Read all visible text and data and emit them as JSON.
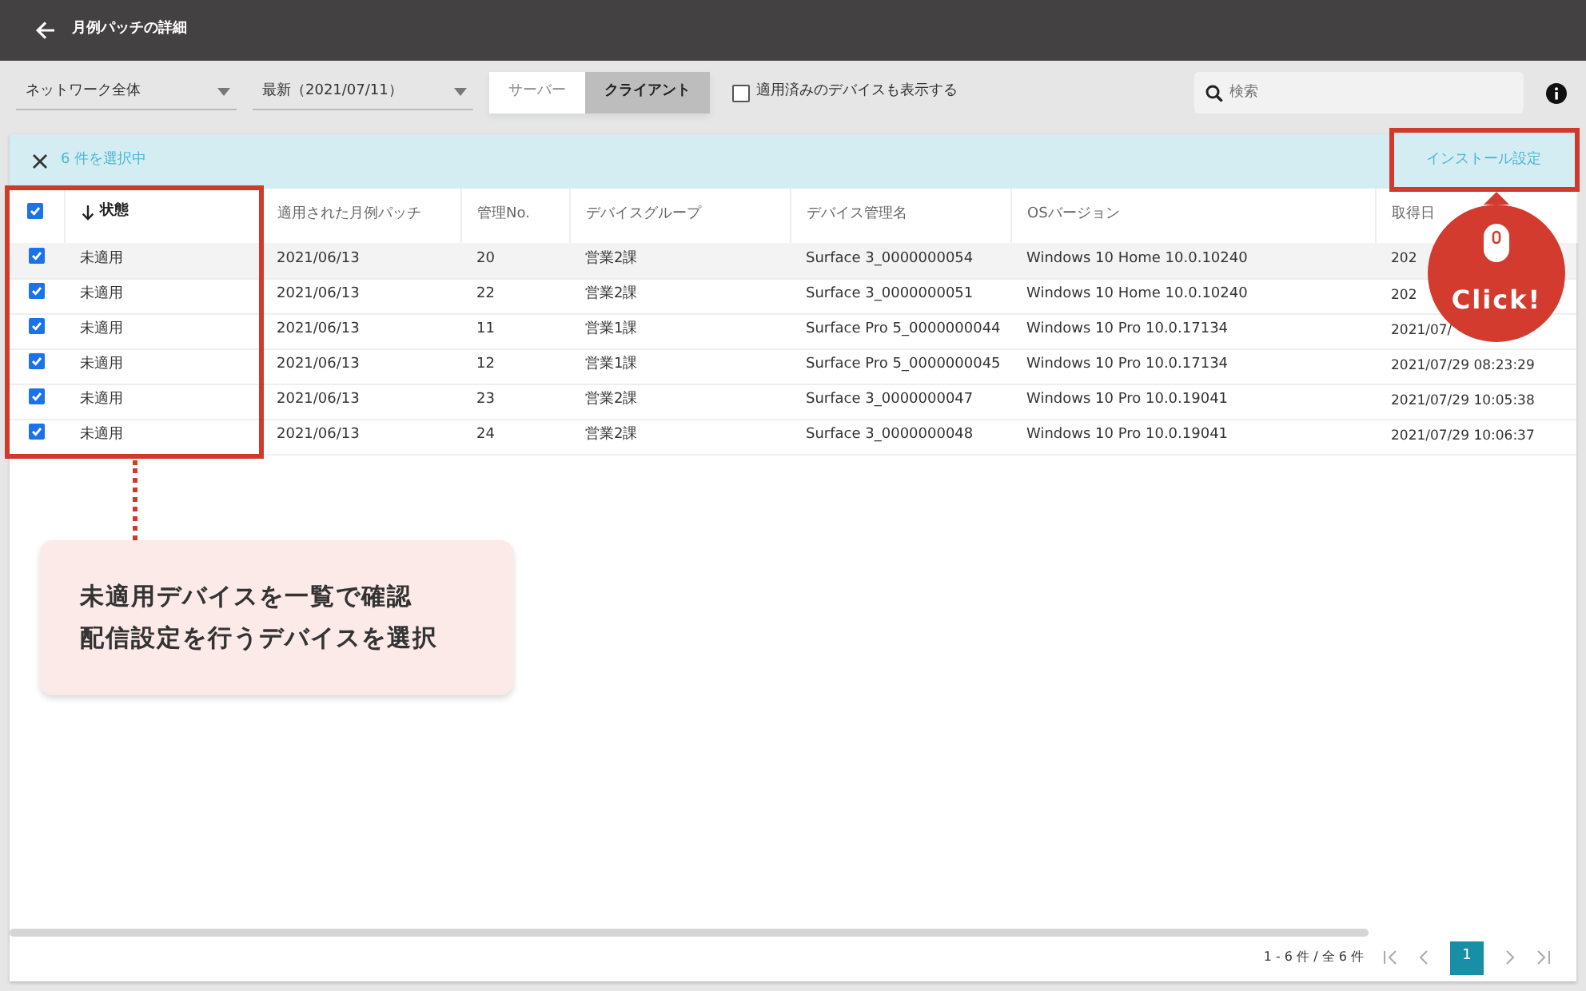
{
  "header": {
    "title": "月例パッチの詳細"
  },
  "toolbar": {
    "network_select": {
      "value": "ネットワーク全体"
    },
    "date_select": {
      "value": "最新（2021/07/11）"
    },
    "segments": [
      {
        "label": "サーバー",
        "selected": false
      },
      {
        "label": "クライアント",
        "selected": true
      }
    ],
    "show_applied": {
      "label": "適用済みのデバイスも表示する",
      "checked": false
    },
    "search": {
      "placeholder": "検索"
    }
  },
  "selection_bar": {
    "count_text": "6 件を選択中",
    "action": "インストール設定"
  },
  "table": {
    "all_checked": true,
    "columns": [
      {
        "label": "状態",
        "sorted": true
      },
      {
        "label": "適用された月例パッチ",
        "sorted": false
      },
      {
        "label": "管理No.",
        "sorted": false
      },
      {
        "label": "デバイスグループ",
        "sorted": false
      },
      {
        "label": "デバイス管理名",
        "sorted": false
      },
      {
        "label": "OSバージョン",
        "sorted": false
      },
      {
        "label": "取得日",
        "sorted": false
      }
    ],
    "rows": [
      {
        "checked": true,
        "cells": [
          "未適用",
          "2021/06/13",
          "20",
          "営業2課",
          "Surface 3_0000000054",
          "Windows 10 Home 10.0.10240",
          "202"
        ]
      },
      {
        "checked": true,
        "cells": [
          "未適用",
          "2021/06/13",
          "22",
          "営業2課",
          "Surface 3_0000000051",
          "Windows 10 Home 10.0.10240",
          "202"
        ]
      },
      {
        "checked": true,
        "cells": [
          "未適用",
          "2021/06/13",
          "11",
          "営業1課",
          "Surface Pro 5_0000000044",
          "Windows 10 Pro 10.0.17134",
          "2021/07/"
        ]
      },
      {
        "checked": true,
        "cells": [
          "未適用",
          "2021/06/13",
          "12",
          "営業1課",
          "Surface Pro 5_0000000045",
          "Windows 10 Pro 10.0.17134",
          "2021/07/29 08:23:29"
        ]
      },
      {
        "checked": true,
        "cells": [
          "未適用",
          "2021/06/13",
          "23",
          "営業2課",
          "Surface 3_0000000047",
          "Windows 10 Pro 10.0.19041",
          "2021/07/29 10:05:38"
        ]
      },
      {
        "checked": true,
        "cells": [
          "未適用",
          "2021/06/13",
          "24",
          "営業2課",
          "Surface 3_0000000048",
          "Windows 10 Pro 10.0.19041",
          "2021/07/29 10:06:37"
        ]
      }
    ]
  },
  "pagination": {
    "range": "1 - 6 件 / 全 6 件",
    "pages": [
      {
        "label": "1",
        "selected": true
      }
    ]
  },
  "annotations": {
    "callout": [
      "未適用デバイスを一覧で確認",
      "配信設定を行うデバイスを選択"
    ],
    "click_badge": "Click!"
  }
}
